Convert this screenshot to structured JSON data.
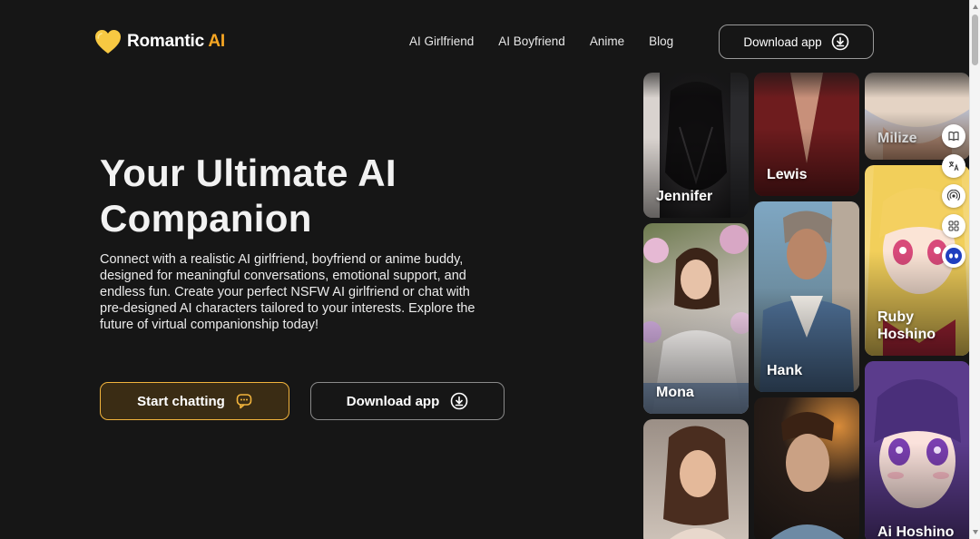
{
  "brand": {
    "name": "Romantic",
    "accent": "AI"
  },
  "nav": {
    "items": [
      {
        "label": "AI Girlfriend"
      },
      {
        "label": "AI Boyfriend"
      },
      {
        "label": "Anime"
      },
      {
        "label": "Blog"
      }
    ],
    "download_label": "Download app"
  },
  "hero": {
    "title_line1": "Your Ultimate AI",
    "title_line2": "Companion",
    "description": "Connect with a realistic AI girlfriend, boyfriend or anime buddy, designed for meaningful conversations, emotional support, and endless fun. Create your perfect NSFW AI girlfriend or chat with pre-designed AI characters tailored to your interests. Explore the future of virtual companionship today!",
    "start_label": "Start chatting",
    "download_label": "Download app"
  },
  "characters": [
    {
      "name": "Jennifer"
    },
    {
      "name": "Mona"
    },
    {
      "name": ""
    },
    {
      "name": "Lewis"
    },
    {
      "name": "Hank"
    },
    {
      "name": ""
    },
    {
      "name": "Milize"
    },
    {
      "name": "Ruby Hoshino"
    },
    {
      "name": "Ai Hoshino"
    }
  ],
  "tools": [
    {
      "icon": "book-icon"
    },
    {
      "icon": "translate-icon"
    },
    {
      "icon": "broadcast-icon"
    },
    {
      "icon": "grid-icon"
    },
    {
      "icon": "assistant-icon"
    }
  ],
  "colors": {
    "background": "#161616",
    "accent": "#f6a623",
    "button_border": "#f2b43c"
  }
}
